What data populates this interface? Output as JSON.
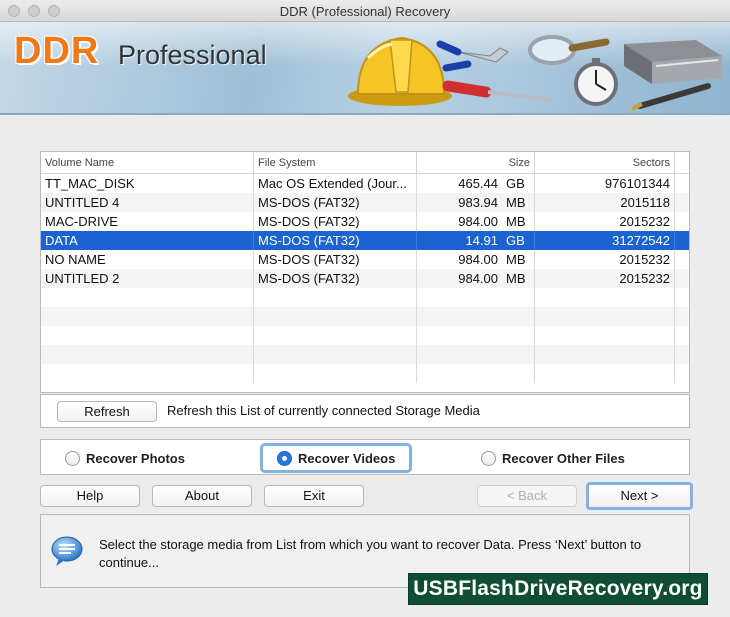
{
  "window": {
    "title": "DDR (Professional) Recovery"
  },
  "banner": {
    "brand_ddr": "DDR",
    "brand_professional": "Professional"
  },
  "table": {
    "columns": [
      "Volume Name",
      "File System",
      "Size",
      "Sectors"
    ],
    "rows": [
      {
        "name": "TT_MAC_DISK",
        "fs": "Mac OS Extended (Jour...",
        "size": "465.44",
        "unit": "GB",
        "sectors": "976101344"
      },
      {
        "name": "UNTITLED 4",
        "fs": "MS-DOS (FAT32)",
        "size": "983.94",
        "unit": "MB",
        "sectors": "2015118"
      },
      {
        "name": "MAC-DRIVE",
        "fs": "MS-DOS (FAT32)",
        "size": "984.00",
        "unit": "MB",
        "sectors": "2015232"
      },
      {
        "name": "DATA",
        "fs": "MS-DOS (FAT32)",
        "size": "14.91",
        "unit": "GB",
        "sectors": "31272542"
      },
      {
        "name": "NO NAME",
        "fs": "MS-DOS (FAT32)",
        "size": "984.00",
        "unit": "MB",
        "sectors": "2015232"
      },
      {
        "name": "UNTITLED 2",
        "fs": "MS-DOS (FAT32)",
        "size": "984.00",
        "unit": "MB",
        "sectors": "2015232"
      }
    ],
    "selected_row": "DATA"
  },
  "refresh": {
    "button_label": "Refresh",
    "description": "Refresh this List of currently connected Storage Media"
  },
  "recovery_mode": {
    "options": [
      "Recover Photos",
      "Recover Videos",
      "Recover Other Files"
    ],
    "selected": "Recover Videos"
  },
  "buttons": {
    "help": "Help",
    "about": "About",
    "exit": "Exit",
    "back": "< Back",
    "next": "Next >"
  },
  "message": "Select the storage media from List from which you want to recover Data. Press ‘Next’ button to continue...",
  "watermark": "USBFlashDriveRecovery.org",
  "colors": {
    "selection": "#1a63d1",
    "brand_orange": "#f07a1a",
    "focus_ring": "#7fb4ea",
    "watermark_bg": "#0f4d35"
  }
}
